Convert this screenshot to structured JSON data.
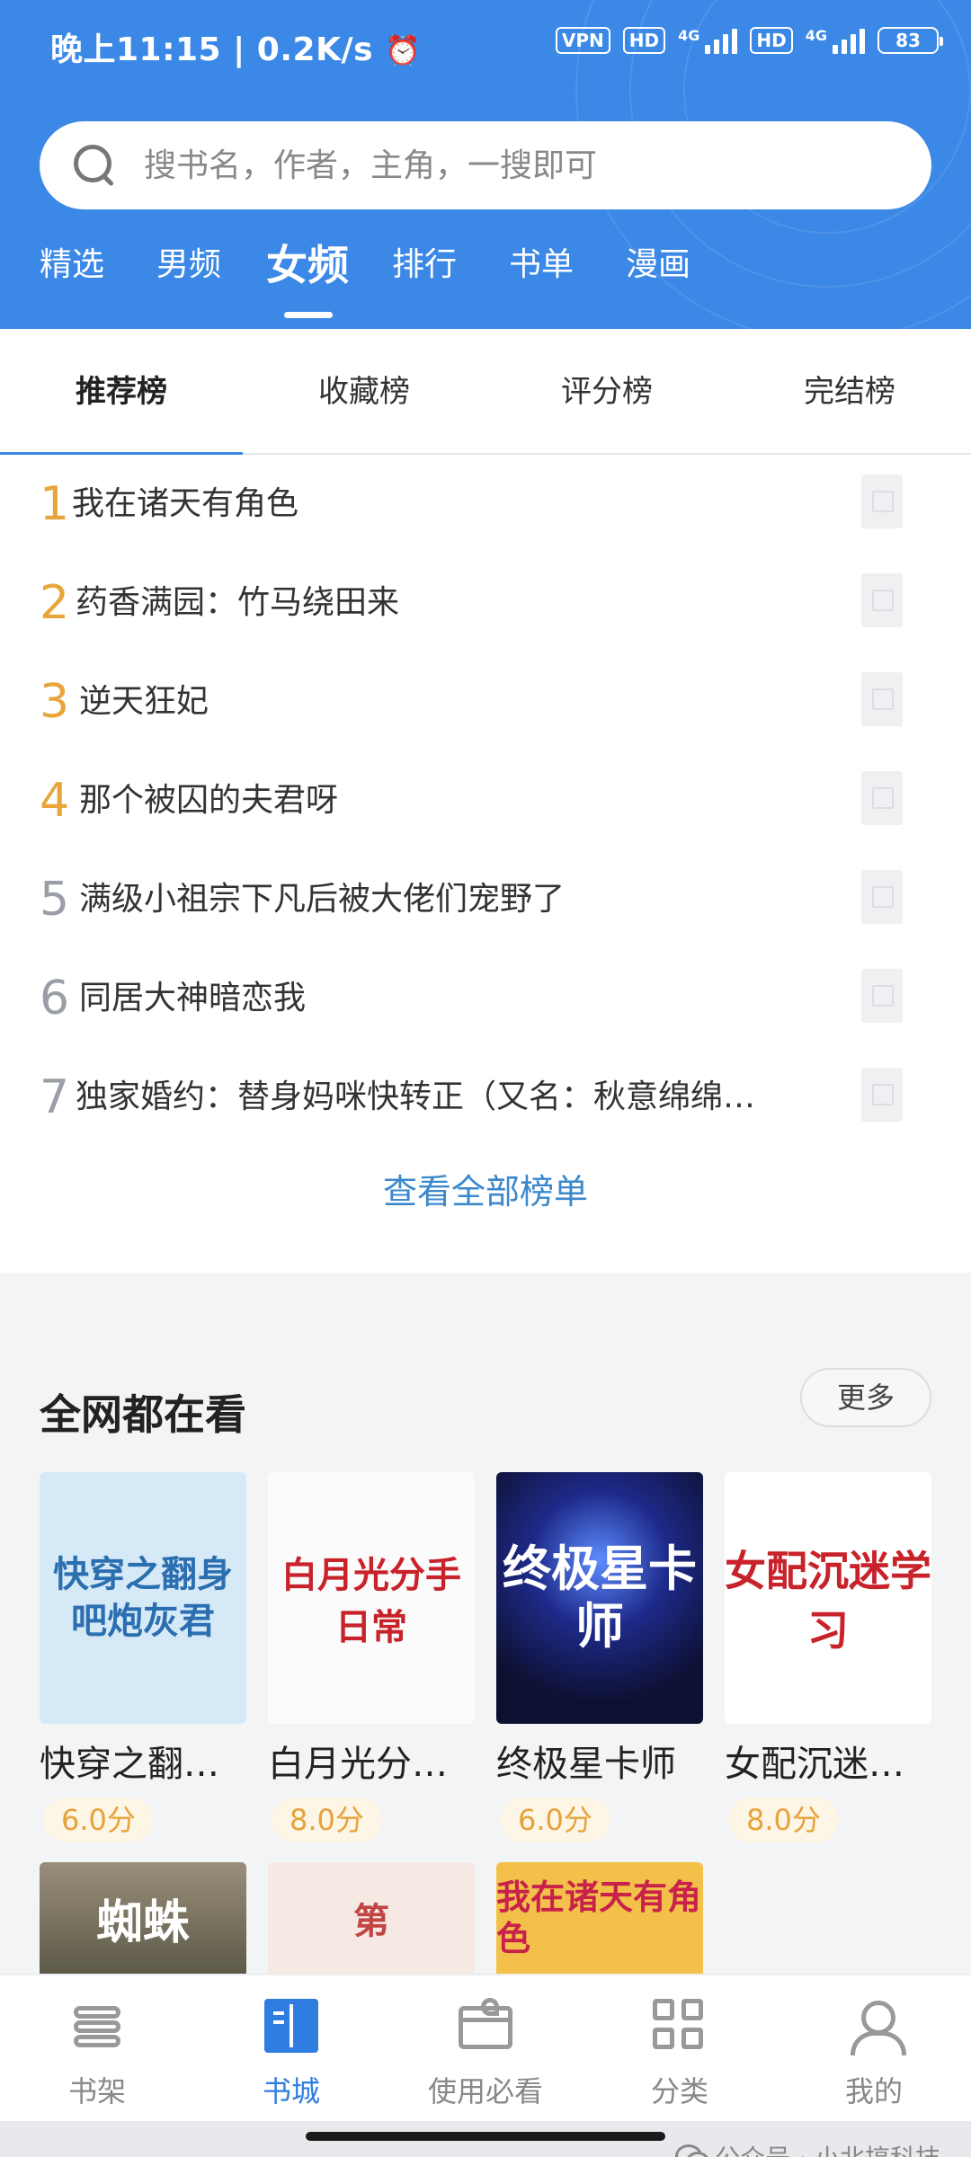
{
  "status_bar": {
    "time": "晚上11:15 | 0.2K/s",
    "vpn": "VPN",
    "hd1": "HD",
    "hd2": "HD",
    "net1": "4G",
    "net2": "4G",
    "battery": "83"
  },
  "search": {
    "placeholder": "搜书名，作者，主角，一搜即可"
  },
  "category_tabs": [
    {
      "label": "精选"
    },
    {
      "label": "男频"
    },
    {
      "label": "女频",
      "active": true
    },
    {
      "label": "排行"
    },
    {
      "label": "书单"
    },
    {
      "label": "漫画"
    }
  ],
  "rank_tabs": [
    {
      "label": "推荐榜",
      "active": true
    },
    {
      "label": "收藏榜"
    },
    {
      "label": "评分榜"
    },
    {
      "label": "完结榜"
    }
  ],
  "rank_list": [
    {
      "rank": "1",
      "title": "我在诸天有角色"
    },
    {
      "rank": "2",
      "title": "药香满园：竹马绕田来"
    },
    {
      "rank": "3",
      "title": "逆天狂妃"
    },
    {
      "rank": "4",
      "title": "那个被囚的夫君呀"
    },
    {
      "rank": "5",
      "title": "满级小祖宗下凡后被大佬们宠野了"
    },
    {
      "rank": "6",
      "title": "同居大神暗恋我"
    },
    {
      "rank": "7",
      "title": "独家婚约：替身妈咪快转正（又名：秋意绵绵…"
    }
  ],
  "rank_colors": {
    "top": "#e8a53a",
    "rest": "#9a9ea6"
  },
  "view_all": "查看全部榜单",
  "section": {
    "title": "全网都在看",
    "more": "更多",
    "books": [
      {
        "title": "快穿之翻…",
        "score": "6.0分",
        "cover_text": "快穿之翻身吧炮灰君"
      },
      {
        "title": "白月光分…",
        "score": "8.0分",
        "cover_text": "白月光分手日常"
      },
      {
        "title": "终极星卡师",
        "score": "6.0分",
        "cover_text": "终极星卡师"
      },
      {
        "title": "女配沉迷…",
        "score": "8.0分",
        "cover_text": "女配沉迷学习"
      }
    ],
    "row2_covers": [
      {
        "cover_text": "蜘蛛"
      },
      {
        "cover_text": "第"
      },
      {
        "cover_text": "我在诸天有角色"
      }
    ]
  },
  "bottom_nav": [
    {
      "label": "书架",
      "icon": "bookshelf-icon"
    },
    {
      "label": "书城",
      "icon": "book-store-icon",
      "active": true
    },
    {
      "label": "使用必看",
      "icon": "gift-icon"
    },
    {
      "label": "分类",
      "icon": "grid-icon"
    },
    {
      "label": "我的",
      "icon": "user-icon"
    }
  ],
  "watermark": "公众号 · 小北搞科技",
  "colors": {
    "brand_blue": "#3b88e6",
    "accent_blue": "#2f7de0",
    "score_gold": "#e6a33a"
  }
}
